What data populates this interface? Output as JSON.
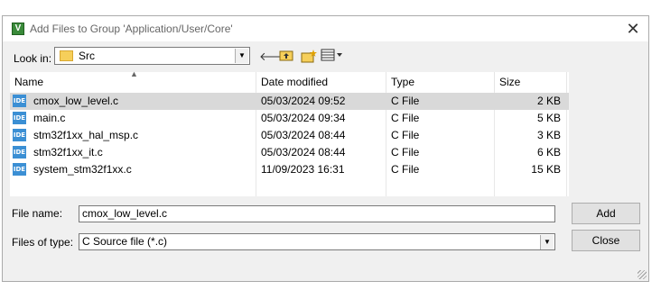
{
  "window": {
    "title": "Add Files to Group 'Application/User/Core'",
    "app_icon": "keil-uvision-icon"
  },
  "look_in": {
    "label": "Look in:",
    "value": "Src"
  },
  "toolbar": {
    "icons": [
      "back-arrow-icon",
      "up-folder-icon",
      "new-folder-icon",
      "view-menu-icon"
    ]
  },
  "file_list": {
    "columns": [
      "Name",
      "Date modified",
      "Type",
      "Size"
    ],
    "rows": [
      {
        "name": "cmox_low_level.c",
        "date": "05/03/2024 09:52",
        "type": "C File",
        "size": "2 KB",
        "selected": true
      },
      {
        "name": "main.c",
        "date": "05/03/2024 09:34",
        "type": "C File",
        "size": "5 KB",
        "selected": false
      },
      {
        "name": "stm32f1xx_hal_msp.c",
        "date": "05/03/2024 08:44",
        "type": "C File",
        "size": "3 KB",
        "selected": false
      },
      {
        "name": "stm32f1xx_it.c",
        "date": "05/03/2024 08:44",
        "type": "C File",
        "size": "6 KB",
        "selected": false
      },
      {
        "name": "system_stm32f1xx.c",
        "date": "11/09/2023 16:31",
        "type": "C File",
        "size": "15 KB",
        "selected": false
      }
    ],
    "file_icon_label": "IDE"
  },
  "file_name": {
    "label": "File name:",
    "value": "cmox_low_level.c"
  },
  "file_type": {
    "label": "Files of type:",
    "value": "C Source file (*.c)"
  },
  "buttons": {
    "add": "Add",
    "close": "Close"
  }
}
